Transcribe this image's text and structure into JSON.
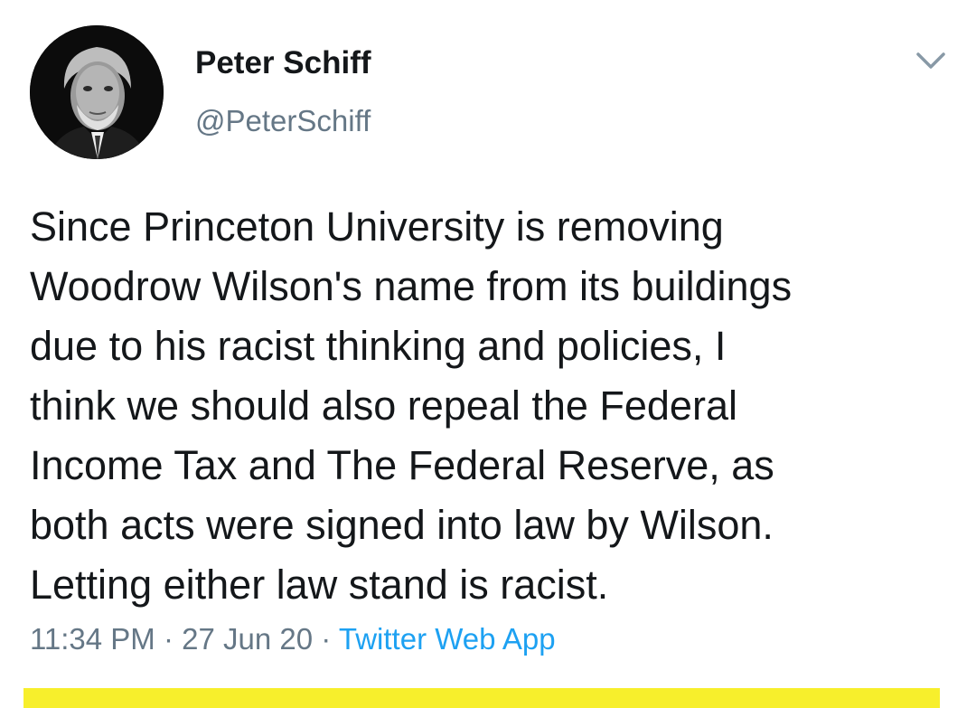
{
  "tweet": {
    "author": {
      "display_name": "Peter Schiff",
      "handle": "@PeterSchiff",
      "avatar_icon": "profile-photo"
    },
    "menu_icon": "chevron-down-icon",
    "text": "Since Princeton University is removing\nWoodrow Wilson's name from its buildings\ndue to his racist thinking and policies, I\nthink we should also repeal the Federal\nIncome Tax and The Federal Reserve, as\nboth acts were signed into law by Wilson.\nLetting either law stand is racist.",
    "time": "11:34 PM",
    "date": "27 Jun 20",
    "separator": "·",
    "source": "Twitter Web App"
  },
  "colors": {
    "text": "#14171a",
    "secondary": "#657786",
    "link": "#1da1f2",
    "highlight_bar": "#f7ef2c"
  }
}
